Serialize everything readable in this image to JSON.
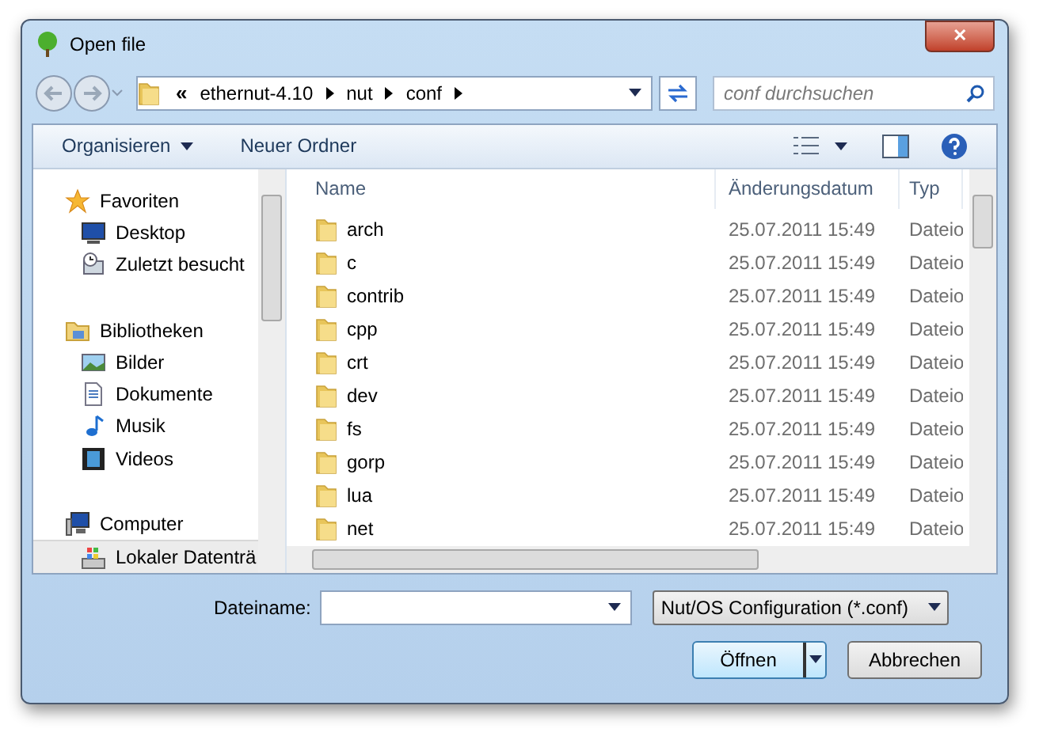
{
  "window": {
    "title": "Open file",
    "close_label": "✕"
  },
  "address": {
    "prefix": "«",
    "crumbs": [
      "ethernut-4.10",
      "nut",
      "conf"
    ]
  },
  "search": {
    "placeholder": "conf durchsuchen"
  },
  "toolbar": {
    "organize": "Organisieren",
    "new_folder": "Neuer Ordner"
  },
  "sidebar": {
    "items": [
      {
        "label": "Favoriten",
        "kind": "group",
        "selected": false
      },
      {
        "label": "Desktop",
        "kind": "item",
        "selected": false
      },
      {
        "label": "Zuletzt besucht",
        "kind": "item",
        "selected": false
      },
      {
        "label": "Bibliotheken",
        "kind": "group",
        "selected": false
      },
      {
        "label": "Bilder",
        "kind": "item",
        "selected": false
      },
      {
        "label": "Dokumente",
        "kind": "item",
        "selected": false
      },
      {
        "label": "Musik",
        "kind": "item",
        "selected": false
      },
      {
        "label": "Videos",
        "kind": "item",
        "selected": false
      },
      {
        "label": "Computer",
        "kind": "group",
        "selected": false
      },
      {
        "label": "Lokaler Datenträ",
        "kind": "item",
        "selected": true
      }
    ]
  },
  "table": {
    "columns": [
      "Name",
      "Änderungsdatum",
      "Typ"
    ],
    "rows": [
      {
        "name": "arch",
        "date": "25.07.2011 15:49",
        "type": "Dateio"
      },
      {
        "name": "c",
        "date": "25.07.2011 15:49",
        "type": "Dateio"
      },
      {
        "name": "contrib",
        "date": "25.07.2011 15:49",
        "type": "Dateio"
      },
      {
        "name": "cpp",
        "date": "25.07.2011 15:49",
        "type": "Dateio"
      },
      {
        "name": "crt",
        "date": "25.07.2011 15:49",
        "type": "Dateio"
      },
      {
        "name": "dev",
        "date": "25.07.2011 15:49",
        "type": "Dateio"
      },
      {
        "name": "fs",
        "date": "25.07.2011 15:49",
        "type": "Dateio"
      },
      {
        "name": "gorp",
        "date": "25.07.2011 15:49",
        "type": "Dateio"
      },
      {
        "name": "lua",
        "date": "25.07.2011 15:49",
        "type": "Dateio"
      },
      {
        "name": "net",
        "date": "25.07.2011 15:49",
        "type": "Dateio"
      }
    ]
  },
  "footer": {
    "filename_label": "Dateiname:",
    "filter": "Nut/OS Configuration (*.conf)",
    "open": "Öffnen",
    "cancel": "Abbrechen"
  }
}
